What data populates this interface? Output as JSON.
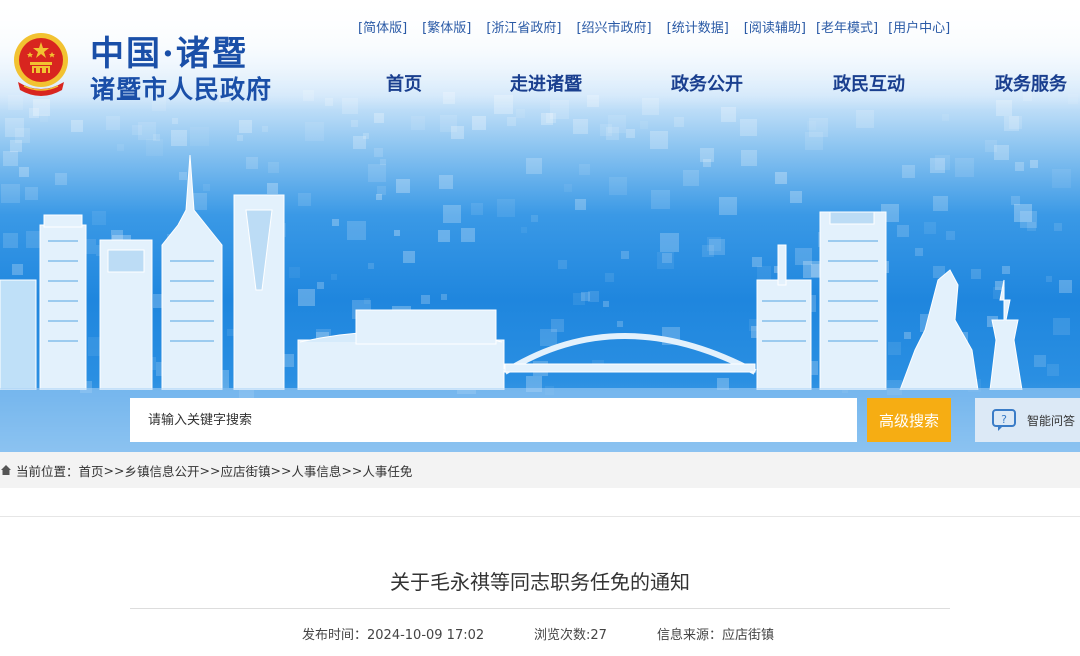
{
  "site": {
    "logo_line1": "中国·诸暨",
    "logo_line2": "诸暨市人民政府"
  },
  "toplinks": [
    "[简体版]",
    "[繁体版]",
    "[浙江省政府]",
    "[绍兴市政府]",
    "[统计数据]",
    "[阅读辅助]",
    "[老年模式]",
    "[用户中心]"
  ],
  "nav": {
    "items": [
      "首页",
      "走进诸暨",
      "政务公开",
      "政民互动",
      "政务服务"
    ]
  },
  "search": {
    "placeholder": "请输入关键字搜索",
    "advanced_label": "高级搜索",
    "qa_label": "智能问答"
  },
  "breadcrumb": {
    "prefix": "当前位置：",
    "items": [
      "首页",
      "乡镇信息公开",
      "应店街镇",
      "人事信息",
      "人事任免"
    ],
    "separator": ">>"
  },
  "article": {
    "title": "关于毛永祺等同志职务任免的通知",
    "publish_time": "发布时间：2024-10-09 17:02",
    "views": "浏览次数:27",
    "source": "信息来源：应店街镇"
  },
  "colors": {
    "brand_blue": "#1a4fa8",
    "nav_blue": "#1a3f8f",
    "accent_orange": "#f6ad13",
    "emblem_red": "#d8251f",
    "emblem_gold": "#f2c231"
  }
}
